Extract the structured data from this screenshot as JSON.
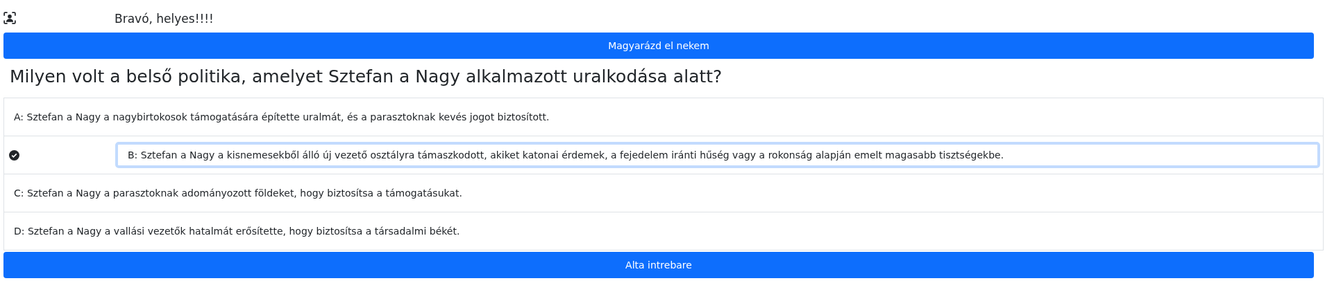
{
  "feedback": {
    "text": "Bravó, helyes!!!!"
  },
  "explain_button": "Magyarázd el nekem",
  "question": "Milyen volt a belső politika, amelyet Sztefan a Nagy alkalmazott uralkodása alatt?",
  "options": [
    {
      "label": "A: Sztefan a Nagy a nagybirtokosok támogatására építette uralmát, és a parasztoknak kevés jogot biztosított.",
      "selected": false
    },
    {
      "label": "B: Sztefan a Nagy a kisnemesekből álló új vezető osztályra támaszkodott, akiket katonai érdemek, a fejedelem iránti hűség vagy a rokonság alapján emelt magasabb tisztségekbe.",
      "selected": true
    },
    {
      "label": "C: Sztefan a Nagy a parasztoknak adományozott földeket, hogy biztosítsa a támogatásukat.",
      "selected": false
    },
    {
      "label": "D: Sztefan a Nagy a vallási vezetők hatalmát erősítette, hogy biztosítsa a társadalmi békét.",
      "selected": false
    }
  ],
  "next_button": "Alta intrebare"
}
